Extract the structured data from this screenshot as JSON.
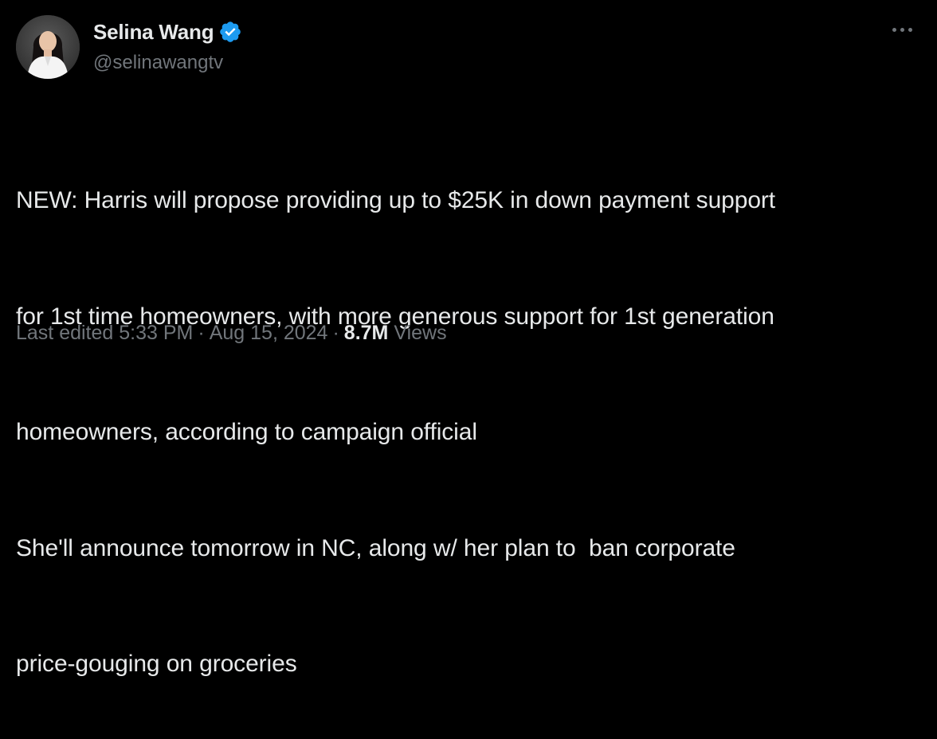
{
  "author": {
    "display_name": "Selina Wang",
    "handle": "@selinawangtv",
    "verified": true,
    "verified_color": "#1d9bf0"
  },
  "post": {
    "lines": [
      "NEW: Harris will propose providing up to $25K in down payment support",
      "for 1st time homeowners, with more generous support for 1st generation",
      "homeowners, according to campaign official",
      "She'll announce tomorrow in NC, along w/ her plan to  ban corporate",
      "price-gouging on groceries"
    ]
  },
  "meta": {
    "edited_prefix": "Last edited",
    "time": "5:33 PM",
    "date": "Aug 15, 2024",
    "separator": "·",
    "views_count": "8.7M",
    "views_label": "Views"
  },
  "icons": {
    "more": "more-horizontal-icon",
    "verified": "verified-badge-icon"
  }
}
